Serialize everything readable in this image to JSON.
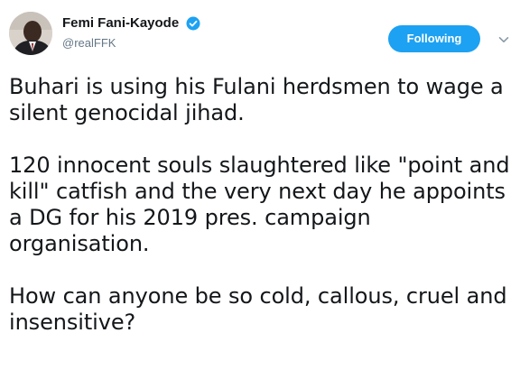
{
  "author": {
    "display_name": "Femi Fani-Kayode",
    "handle": "@realFFK",
    "verified": true,
    "avatar": "profile-photo"
  },
  "actions": {
    "follow_label": "Following",
    "follow_color": "#1da1f2",
    "menu_icon": "chevron-down-icon"
  },
  "tweet": {
    "paragraphs": [
      "Buhari is using his Fulani herdsmen to wage a silent genocidal jihad.",
      "120 innocent souls slaughtered like \"point and kill\" catfish and the very next day he appoints a DG for his 2019 pres. campaign organisation.",
      "How can anyone be so cold, callous, cruel and insensitive?"
    ]
  },
  "colors": {
    "text": "#14171a",
    "secondary_text": "#657786",
    "verified_badge": "#1da1f2"
  }
}
